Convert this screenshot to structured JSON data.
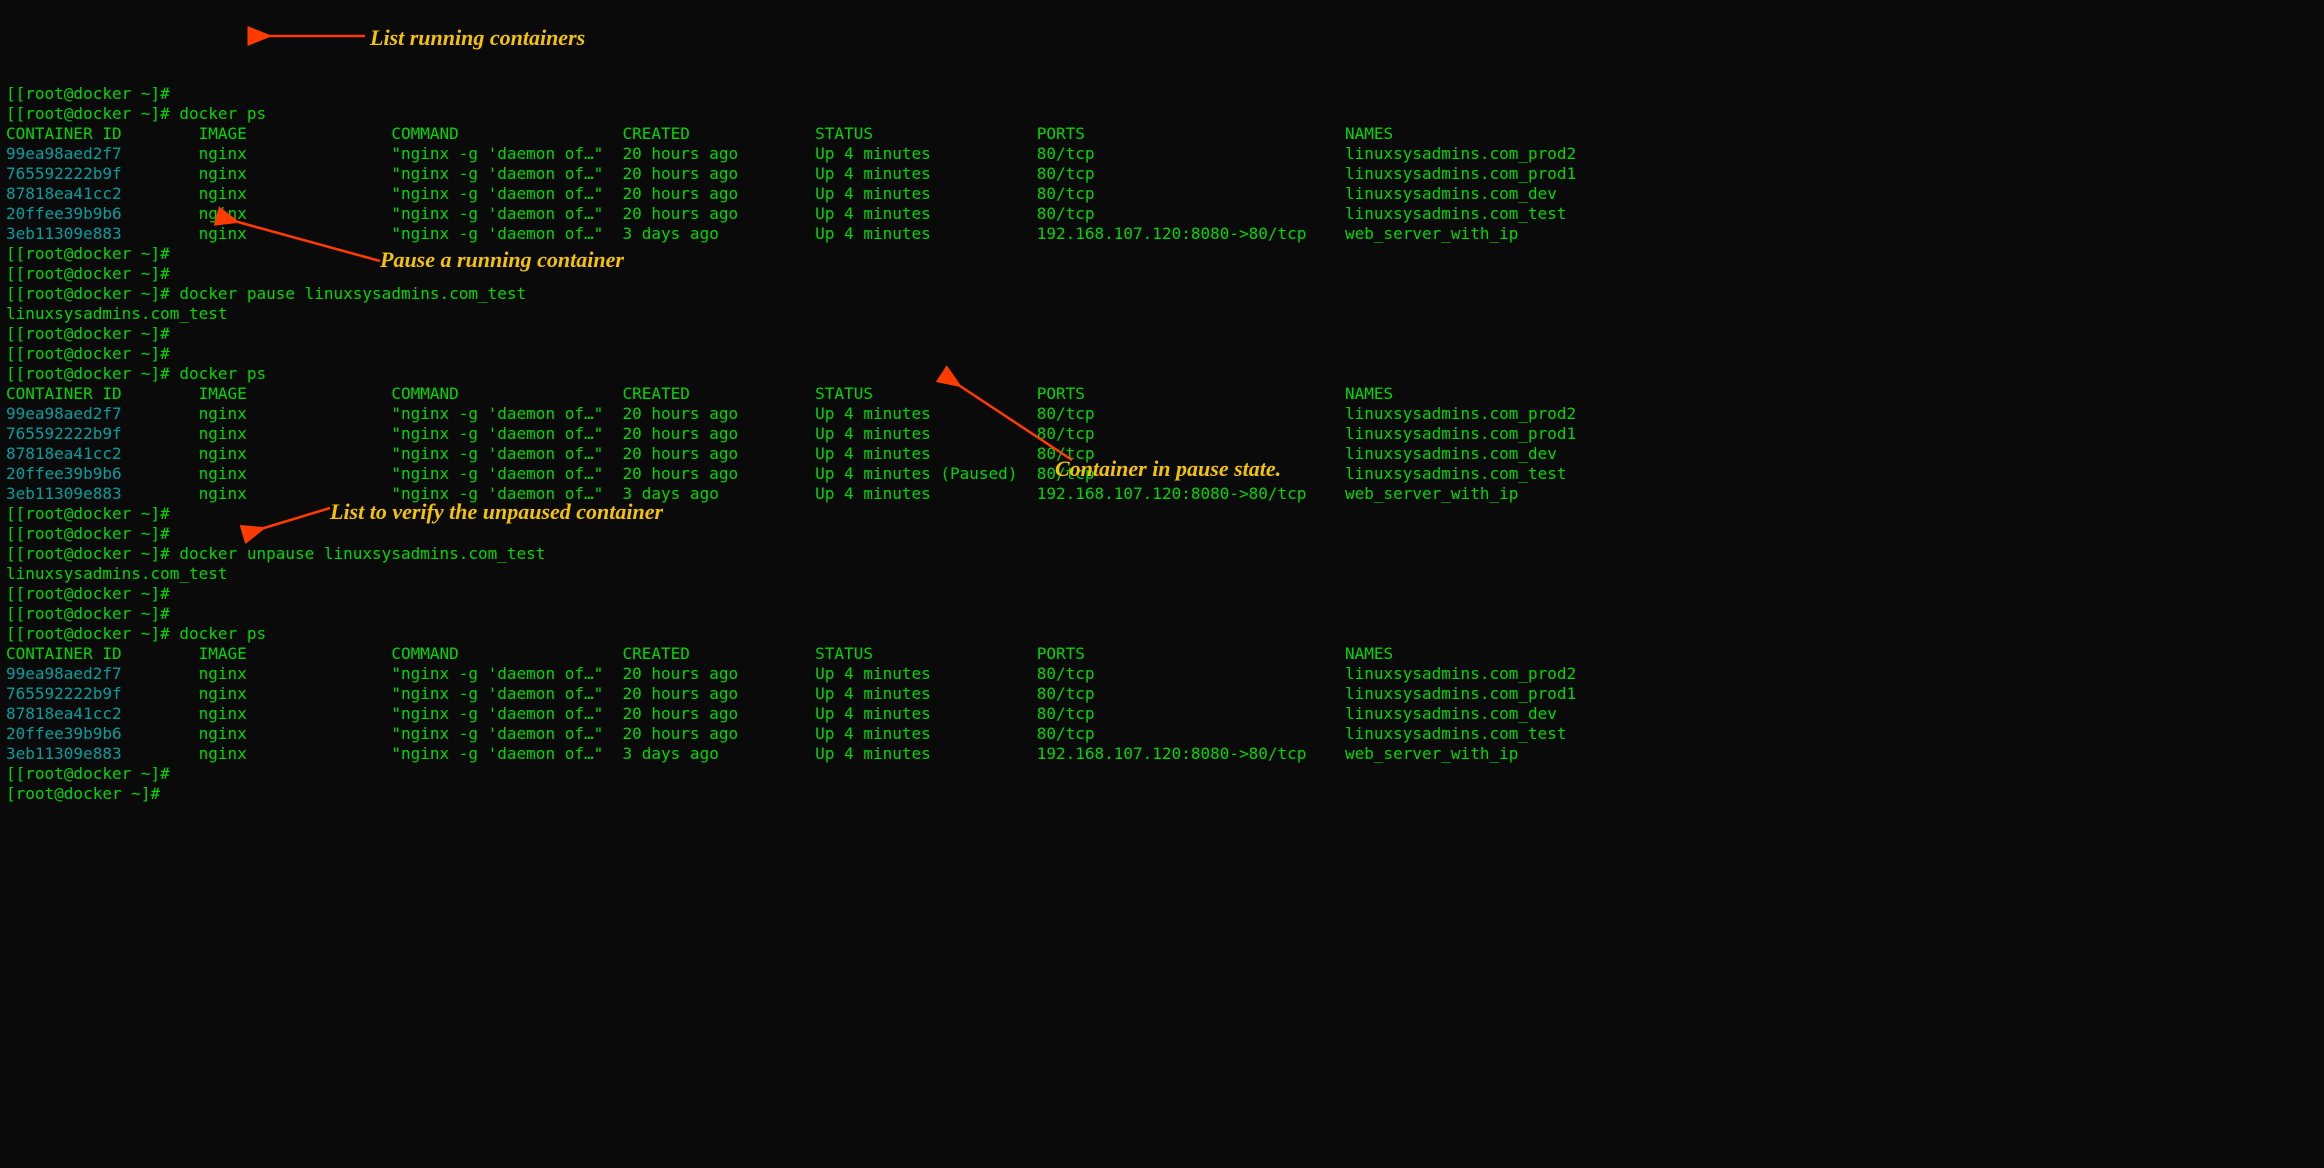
{
  "prompt": "[root@docker ~]# ",
  "bracketed_prompt": "[[root@docker ~]# ",
  "commands": {
    "ps1": "docker ps",
    "pause": "docker pause linuxsysadmins.com_test",
    "pause_echo": "linuxsysadmins.com_test",
    "ps2": "docker ps",
    "unpause": "docker unpause linuxsysadmins.com_test",
    "unpause_echo": "linuxsysadmins.com_test",
    "ps3": "docker ps"
  },
  "columns": {
    "id": "CONTAINER ID",
    "image": "IMAGE",
    "command": "COMMAND",
    "created": "CREATED",
    "status": "STATUS",
    "ports": "PORTS",
    "names": "NAMES"
  },
  "table1": [
    {
      "id": "99ea98aed2f7",
      "image": "nginx",
      "command": "\"nginx -g 'daemon of…\"",
      "created": "20 hours ago",
      "status": "Up 4 minutes",
      "ports": "80/tcp",
      "names": "linuxsysadmins.com_prod2"
    },
    {
      "id": "765592222b9f",
      "image": "nginx",
      "command": "\"nginx -g 'daemon of…\"",
      "created": "20 hours ago",
      "status": "Up 4 minutes",
      "ports": "80/tcp",
      "names": "linuxsysadmins.com_prod1"
    },
    {
      "id": "87818ea41cc2",
      "image": "nginx",
      "command": "\"nginx -g 'daemon of…\"",
      "created": "20 hours ago",
      "status": "Up 4 minutes",
      "ports": "80/tcp",
      "names": "linuxsysadmins.com_dev"
    },
    {
      "id": "20ffee39b9b6",
      "image": "nginx",
      "command": "\"nginx -g 'daemon of…\"",
      "created": "20 hours ago",
      "status": "Up 4 minutes",
      "ports": "80/tcp",
      "names": "linuxsysadmins.com_test"
    },
    {
      "id": "3eb11309e883",
      "image": "nginx",
      "command": "\"nginx -g 'daemon of…\"",
      "created": "3 days ago",
      "status": "Up 4 minutes",
      "ports": "192.168.107.120:8080->80/tcp",
      "names": "web_server_with_ip"
    }
  ],
  "table2": [
    {
      "id": "99ea98aed2f7",
      "image": "nginx",
      "command": "\"nginx -g 'daemon of…\"",
      "created": "20 hours ago",
      "status": "Up 4 minutes",
      "ports": "80/tcp",
      "names": "linuxsysadmins.com_prod2"
    },
    {
      "id": "765592222b9f",
      "image": "nginx",
      "command": "\"nginx -g 'daemon of…\"",
      "created": "20 hours ago",
      "status": "Up 4 minutes",
      "ports": "80/tcp",
      "names": "linuxsysadmins.com_prod1"
    },
    {
      "id": "87818ea41cc2",
      "image": "nginx",
      "command": "\"nginx -g 'daemon of…\"",
      "created": "20 hours ago",
      "status": "Up 4 minutes",
      "ports": "80/tcp",
      "names": "linuxsysadmins.com_dev"
    },
    {
      "id": "20ffee39b9b6",
      "image": "nginx",
      "command": "\"nginx -g 'daemon of…\"",
      "created": "20 hours ago",
      "status": "Up 4 minutes (Paused)",
      "ports": "80/tcp",
      "names": "linuxsysadmins.com_test"
    },
    {
      "id": "3eb11309e883",
      "image": "nginx",
      "command": "\"nginx -g 'daemon of…\"",
      "created": "3 days ago",
      "status": "Up 4 minutes",
      "ports": "192.168.107.120:8080->80/tcp",
      "names": "web_server_with_ip"
    }
  ],
  "table3": [
    {
      "id": "99ea98aed2f7",
      "image": "nginx",
      "command": "\"nginx -g 'daemon of…\"",
      "created": "20 hours ago",
      "status": "Up 4 minutes",
      "ports": "80/tcp",
      "names": "linuxsysadmins.com_prod2"
    },
    {
      "id": "765592222b9f",
      "image": "nginx",
      "command": "\"nginx -g 'daemon of…\"",
      "created": "20 hours ago",
      "status": "Up 4 minutes",
      "ports": "80/tcp",
      "names": "linuxsysadmins.com_prod1"
    },
    {
      "id": "87818ea41cc2",
      "image": "nginx",
      "command": "\"nginx -g 'daemon of…\"",
      "created": "20 hours ago",
      "status": "Up 4 minutes",
      "ports": "80/tcp",
      "names": "linuxsysadmins.com_dev"
    },
    {
      "id": "20ffee39b9b6",
      "image": "nginx",
      "command": "\"nginx -g 'daemon of…\"",
      "created": "20 hours ago",
      "status": "Up 4 minutes",
      "ports": "80/tcp",
      "names": "linuxsysadmins.com_test"
    },
    {
      "id": "3eb11309e883",
      "image": "nginx",
      "command": "\"nginx -g 'daemon of…\"",
      "created": "3 days ago",
      "status": "Up 4 minutes",
      "ports": "192.168.107.120:8080->80/tcp",
      "names": "web_server_with_ip"
    }
  ],
  "captions": {
    "c1": "List running containers",
    "c2": "Pause a running container",
    "c3": "Container in pause state.",
    "c4": "List to verify the unpaused container"
  },
  "arrow_color": "#ff3b00"
}
